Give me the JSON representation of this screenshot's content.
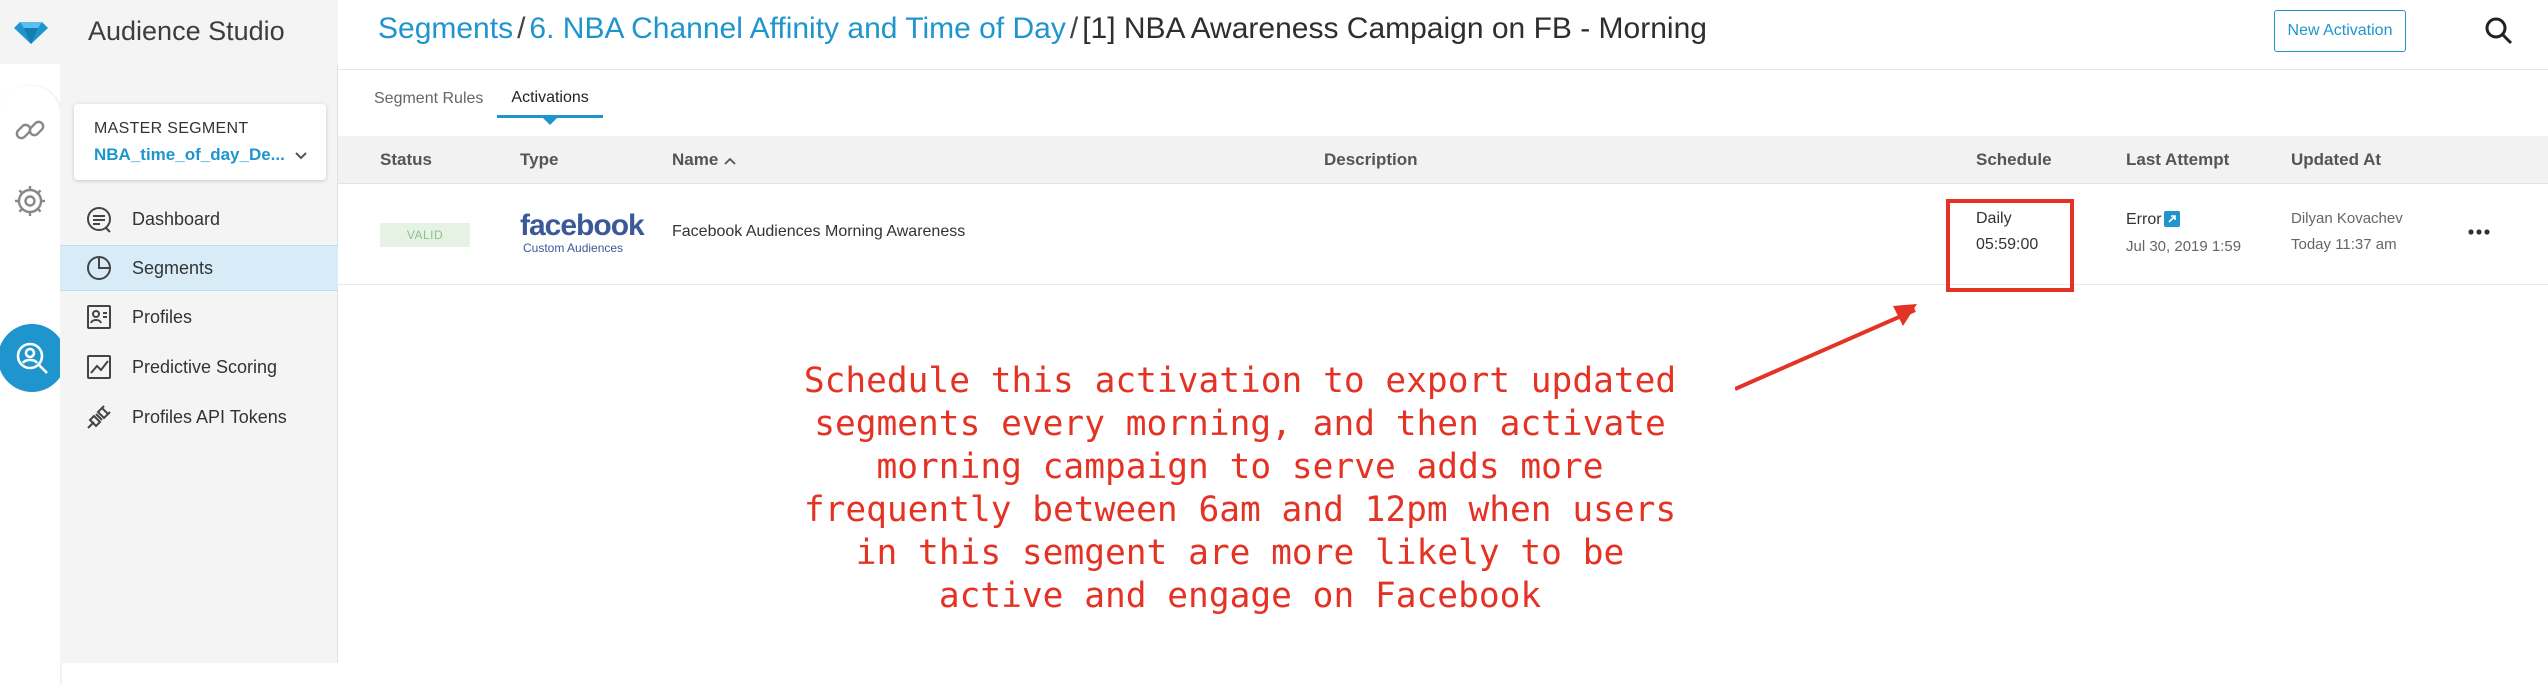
{
  "app": {
    "title": "Audience Studio"
  },
  "master_segment": {
    "label": "MASTER SEGMENT",
    "value": "NBA_time_of_day_De..."
  },
  "nav": [
    {
      "label": "Dashboard",
      "icon": "dashboard-icon"
    },
    {
      "label": "Segments",
      "icon": "pie-chart-icon",
      "active": true
    },
    {
      "label": "Profiles",
      "icon": "profile-card-icon"
    },
    {
      "label": "Predictive Scoring",
      "icon": "line-chart-icon"
    },
    {
      "label": "Profiles API Tokens",
      "icon": "plug-icon"
    }
  ],
  "breadcrumb": {
    "root": "Segments",
    "parent": "6. NBA Channel Affinity and Time of Day",
    "current": "[1] NBA Awareness Campaign on FB - Morning",
    "separator": "/"
  },
  "actions": {
    "new_activation": "New Activation"
  },
  "tabs": [
    {
      "label": "Segment Rules"
    },
    {
      "label": "Activations",
      "active": true
    }
  ],
  "table": {
    "columns": [
      "Status",
      "Type",
      "Name",
      "Description",
      "Schedule",
      "Last Attempt",
      "Updated At"
    ],
    "rows": [
      {
        "status": "VALID",
        "type_logo": "facebook",
        "type_sub": "Custom Audiences",
        "name": "Facebook Audiences Morning Awareness",
        "description": "",
        "schedule_freq": "Daily",
        "schedule_time": "05:59:00",
        "last_attempt_status": "Error",
        "last_attempt_time": "Jul 30, 2019 1:59",
        "updated_by": "Dilyan Kovachev",
        "updated_at": "Today 11:37 am"
      }
    ]
  },
  "annotation": {
    "lines": [
      "Schedule this activation to export updated",
      "segments every morning, and then activate",
      "morning campaign to serve adds more",
      "frequently between 6am and 12pm when users",
      "in this semgent are more likely to be",
      "active and engage on Facebook"
    ]
  },
  "colors": {
    "accent": "#1f95ce",
    "annotation": "#e43224",
    "facebook": "#3b5998",
    "valid_bg": "#e5f2e4"
  }
}
